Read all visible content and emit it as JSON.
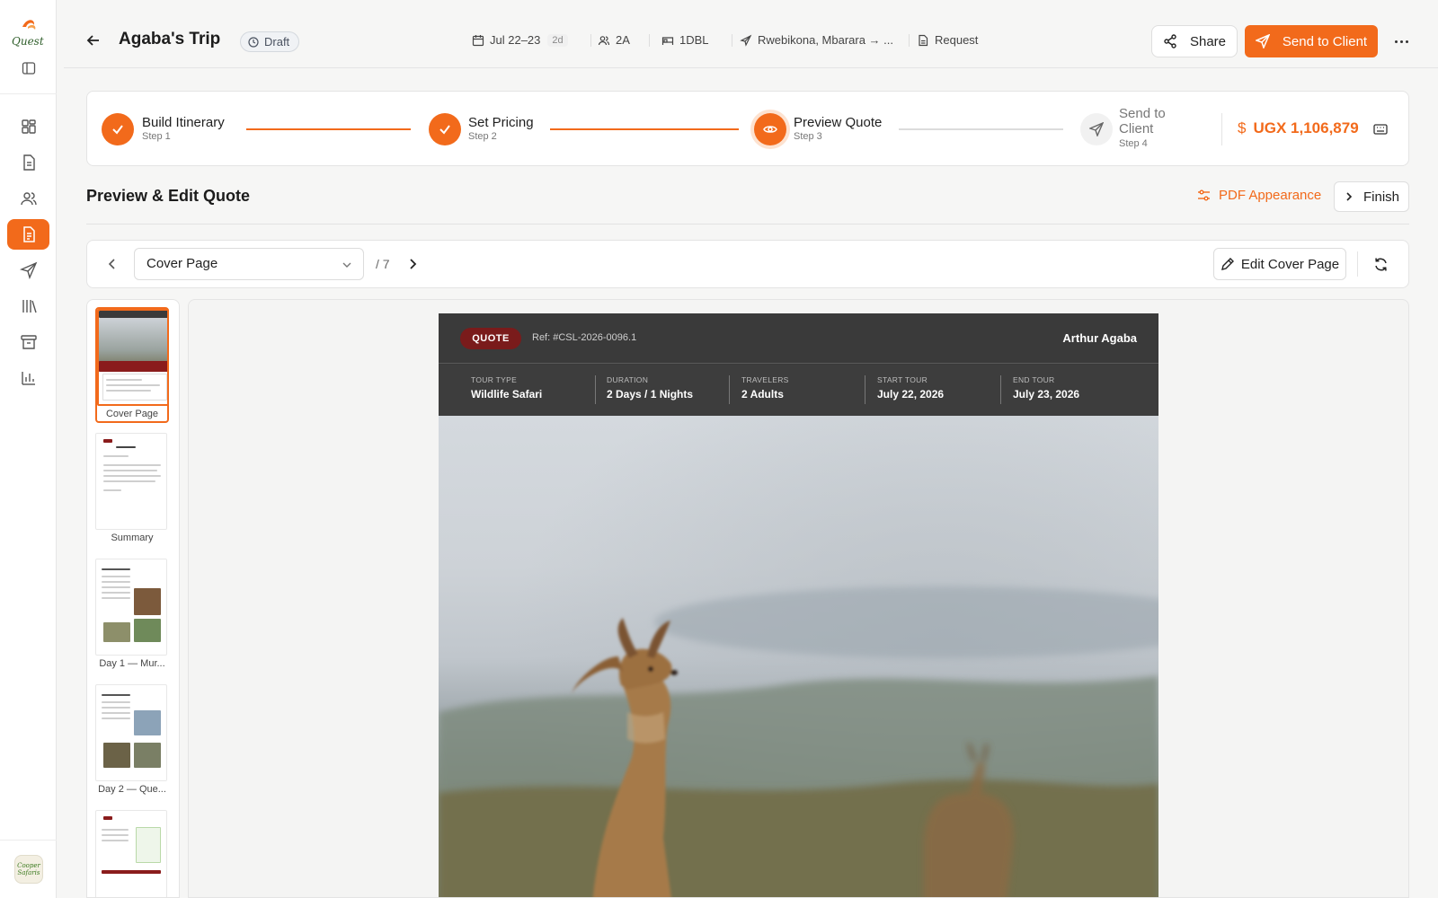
{
  "header": {
    "title": "Agaba's Trip",
    "status": "Draft",
    "dates": "Jul 22–23",
    "duration": "2d",
    "travelers": "2A",
    "rooms": "1DBL",
    "route": "Rwebikona, Mbarara → ...",
    "request": "Request",
    "share_label": "Share",
    "send_label": "Send to Client"
  },
  "stepper": {
    "steps": [
      {
        "label": "Build Itinerary",
        "sub": "Step 1",
        "state": "done"
      },
      {
        "label": "Set Pricing",
        "sub": "Step 2",
        "state": "done"
      },
      {
        "label": "Preview Quote",
        "sub": "Step 3",
        "state": "current"
      },
      {
        "label": "Send to Client",
        "sub": "Step 4",
        "state": "todo"
      }
    ],
    "price": "UGX 1,106,879",
    "currency_symbol": "$"
  },
  "section": {
    "title": "Preview & Edit Quote",
    "pdf_appearance": "PDF Appearance",
    "finish": "Finish"
  },
  "pagenav": {
    "selected_page": "Cover Page",
    "page_total": "/ 7",
    "edit_label": "Edit Cover Page"
  },
  "thumbnails": [
    {
      "caption": "Cover Page",
      "active": true
    },
    {
      "caption": "Summary",
      "active": false
    },
    {
      "caption": "Day 1 — Mur...",
      "active": false
    },
    {
      "caption": "Day 2 — Que...",
      "active": false
    },
    {
      "caption": "",
      "active": false
    }
  ],
  "document": {
    "badge": "QUOTE",
    "ref": "Ref: #CSL-2026-0096.1",
    "client": "Arthur Agaba",
    "facts": [
      {
        "key": "TOUR TYPE",
        "value": "Wildlife Safari"
      },
      {
        "key": "DURATION",
        "value": "2 Days / 1 Nights"
      },
      {
        "key": "TRAVELERS",
        "value": "2 Adults"
      },
      {
        "key": "START TOUR",
        "value": "July 22, 2026"
      },
      {
        "key": "END TOUR",
        "value": "July 23, 2026"
      }
    ]
  },
  "sidebar": {
    "logo_text": "Quest",
    "brand_text": "Cooper Safaris",
    "items": [
      {
        "icon": "dashboard-icon",
        "active": false
      },
      {
        "icon": "document-icon",
        "active": false
      },
      {
        "icon": "users-icon",
        "active": false
      },
      {
        "icon": "quote-document-icon",
        "active": true
      },
      {
        "icon": "send-icon",
        "active": false
      },
      {
        "icon": "library-icon",
        "active": false
      },
      {
        "icon": "archive-icon",
        "active": false
      },
      {
        "icon": "reports-icon",
        "active": false
      }
    ]
  },
  "colors": {
    "accent": "#f26a1b",
    "quote_badge": "#7a1b1b",
    "doc_header": "#3a3a3a"
  }
}
